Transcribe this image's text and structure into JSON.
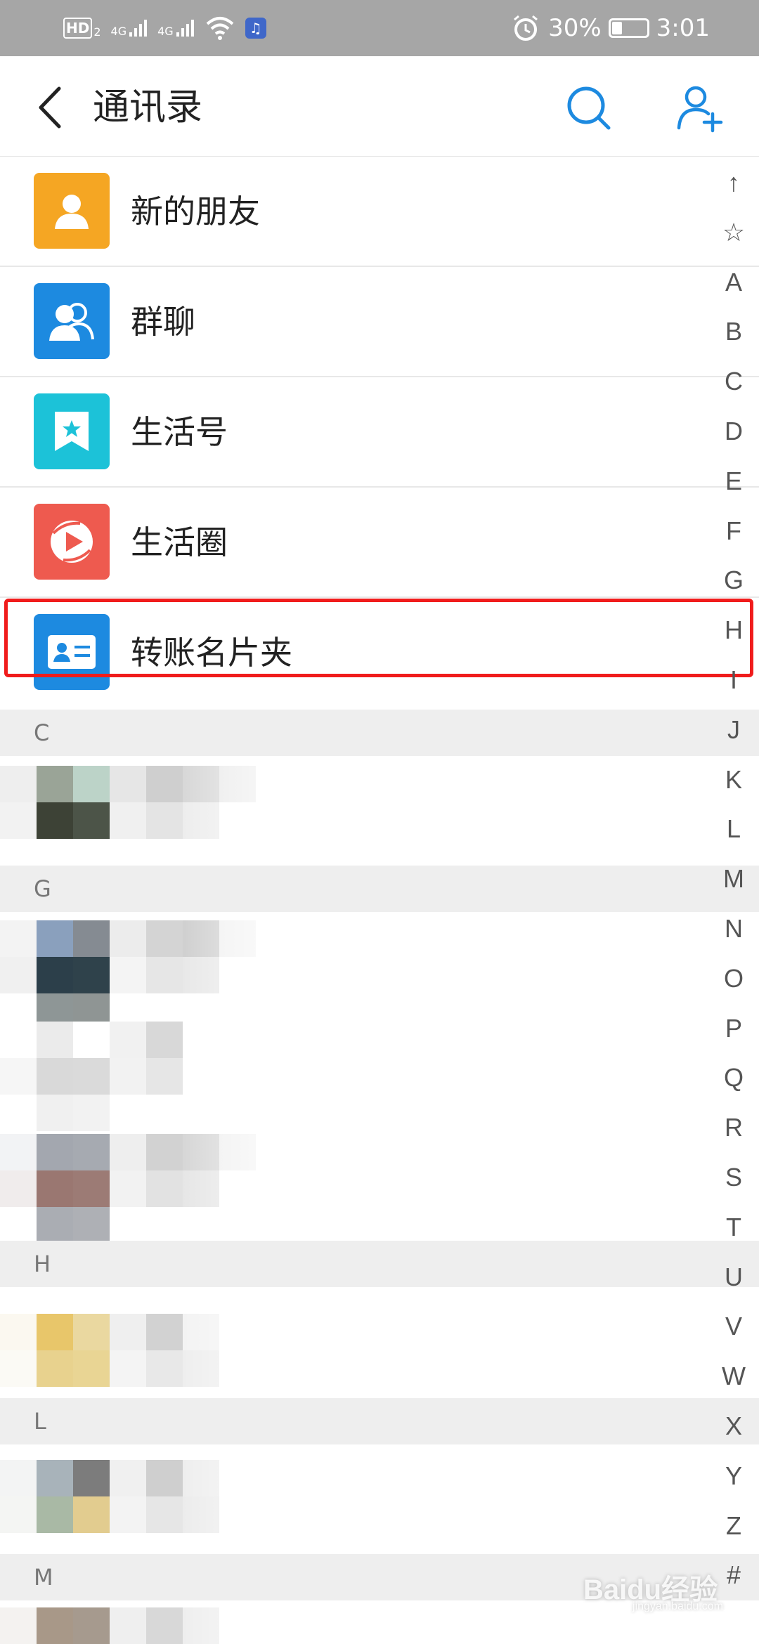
{
  "status_bar": {
    "hd_label": "HD",
    "hd_sub": "2",
    "signal1_label": "4G",
    "signal2_label": "4G",
    "battery_percent": "30%",
    "battery_level": 0.3,
    "time": "3:01"
  },
  "header": {
    "title": "通讯录"
  },
  "entries": [
    {
      "label": "新的朋友",
      "color": "#f5a623"
    },
    {
      "label": "群聊",
      "color": "#1d8ae0"
    },
    {
      "label": "生活号",
      "color": "#1cc2d8"
    },
    {
      "label": "生活圈",
      "color": "#ee5a4f"
    },
    {
      "label": "转账名片夹",
      "color": "#1d8ae0"
    }
  ],
  "sections": [
    {
      "letter": "C"
    },
    {
      "letter": "G"
    },
    {
      "letter": "H"
    },
    {
      "letter": "L"
    },
    {
      "letter": "M"
    }
  ],
  "index_bar": [
    "↑",
    "☆",
    "A",
    "B",
    "C",
    "D",
    "E",
    "F",
    "G",
    "H",
    "I",
    "J",
    "K",
    "L",
    "M",
    "N",
    "O",
    "P",
    "Q",
    "R",
    "S",
    "T",
    "U",
    "V",
    "W",
    "X",
    "Y",
    "Z",
    "#"
  ],
  "watermark": {
    "main": "Baidu经验",
    "sub": "jingyan.baidu.com"
  },
  "colors": {
    "accent": "#1d8ae0",
    "highlight": "#f01c1c",
    "status_bar_bg": "#a6a6a6"
  }
}
